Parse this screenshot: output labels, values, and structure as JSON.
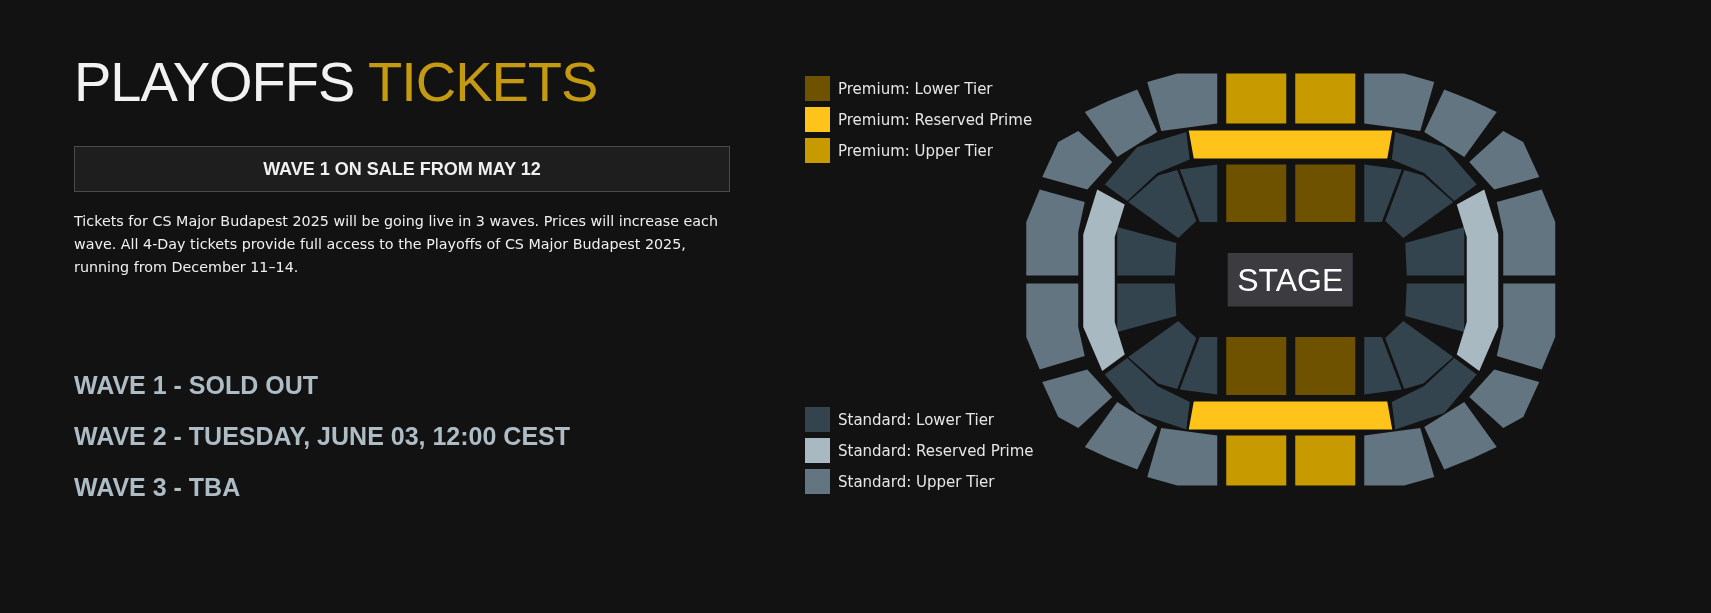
{
  "title": {
    "main": "PLAYOFFS",
    "accent": "TICKETS"
  },
  "banner": "WAVE 1 ON SALE FROM MAY 12",
  "description": "Tickets for CS Major Budapest 2025 will be going live in 3 waves. Prices will increase each wave. All 4-Day tickets provide full access to the Playoffs of CS Major Budapest 2025, running from December 11–14.",
  "waves": [
    "WAVE 1 - SOLD OUT",
    "WAVE 2 - TUESDAY, JUNE 03, 12:00 CEST",
    "WAVE 3 - TBA"
  ],
  "legend_groups": [
    {
      "items": [
        {
          "label": "Premium: Lower Tier",
          "color": "#6e5200"
        },
        {
          "label": "Premium: Reserved Prime",
          "color": "#ffc31a"
        },
        {
          "label": "Premium: Upper Tier",
          "color": "#c79a00"
        }
      ]
    },
    {
      "items": [
        {
          "label": "Standard: Lower Tier",
          "color": "#33444e"
        },
        {
          "label": "Standard: Reserved Prime",
          "color": "#a9b9c2"
        },
        {
          "label": "Standard: Upper Tier",
          "color": "#627580"
        }
      ]
    }
  ],
  "stage_label": "STAGE"
}
